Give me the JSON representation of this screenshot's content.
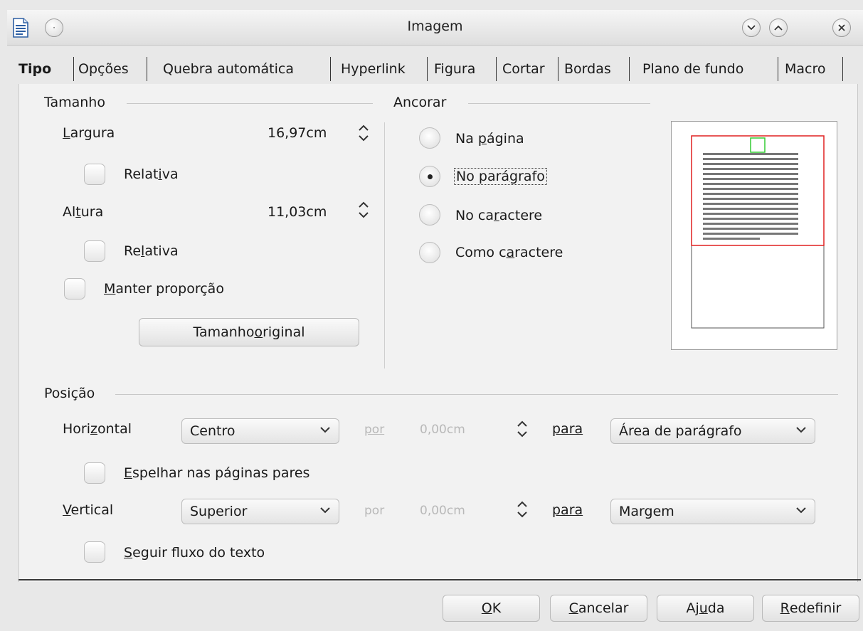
{
  "window": {
    "title": "Imagem",
    "icons": [
      "document-icon",
      "menu-circle-icon",
      "minimize-icon",
      "maximize-icon",
      "close-icon"
    ]
  },
  "tabs": [
    {
      "label": "Tipo",
      "active": true
    },
    {
      "label": "Opções"
    },
    {
      "label": "Quebra automática"
    },
    {
      "label": "Hyperlink"
    },
    {
      "label": "Figura"
    },
    {
      "label": "Cortar"
    },
    {
      "label": "Bordas"
    },
    {
      "label": "Plano de fundo"
    },
    {
      "label": "Macro"
    }
  ],
  "size": {
    "title": "Tamanho",
    "width_label_pre": "",
    "width_label_ul": "L",
    "width_label_post": "argura",
    "width_value": "16,97cm",
    "width_relative_pre": "Relat",
    "width_relative_ul": "i",
    "width_relative_post": "va",
    "height_label_pre": "Al",
    "height_label_ul": "t",
    "height_label_post": "ura",
    "height_value": "11,03cm",
    "height_relative_pre": "Re",
    "height_relative_ul": "l",
    "height_relative_post": "ativa",
    "keep_ratio_pre": "",
    "keep_ratio_ul": "M",
    "keep_ratio_post": "anter proporção",
    "original_pre": "Tamanho ",
    "original_ul": "o",
    "original_post": "riginal"
  },
  "anchor": {
    "title": "Ancorar",
    "options": [
      {
        "pre": "Na ",
        "ul": "p",
        "post": "ágina",
        "selected": false
      },
      {
        "pre": "No pará",
        "ul": "g",
        "post": "rafo",
        "selected": true
      },
      {
        "pre": "No ca",
        "ul": "r",
        "post": "actere",
        "selected": false
      },
      {
        "pre": "Como c",
        "ul": "a",
        "post": "ractere",
        "selected": false
      }
    ]
  },
  "position": {
    "title": "Posição",
    "horizontal_pre": "Hori",
    "horizontal_ul": "z",
    "horizontal_post": "ontal",
    "horizontal_value": "Centro",
    "by_label": "por",
    "horizontal_offset": "0,00cm",
    "to_label": "para",
    "horizontal_to": "Área de parágrafo",
    "mirror_pre": "",
    "mirror_ul": "E",
    "mirror_post": "spelhar nas páginas pares",
    "vertical_pre": "",
    "vertical_ul": "V",
    "vertical_post": "ertical",
    "vertical_value": "Superior",
    "vertical_offset": "0,00cm",
    "vertical_to": "Margem",
    "follow_pre": "",
    "follow_ul": "S",
    "follow_post": "eguir fluxo do texto"
  },
  "buttons": {
    "ok_ul": "O",
    "ok_post": "K",
    "cancel_ul": "C",
    "cancel_post": "ancelar",
    "help_pre": "Aj",
    "help_ul": "u",
    "help_post": "da",
    "reset_ul": "R",
    "reset_post": "edefinir"
  },
  "colors": {
    "preview_frame": "#e02020",
    "preview_image": "#33cc33",
    "preview_text_lines": "#777777"
  }
}
